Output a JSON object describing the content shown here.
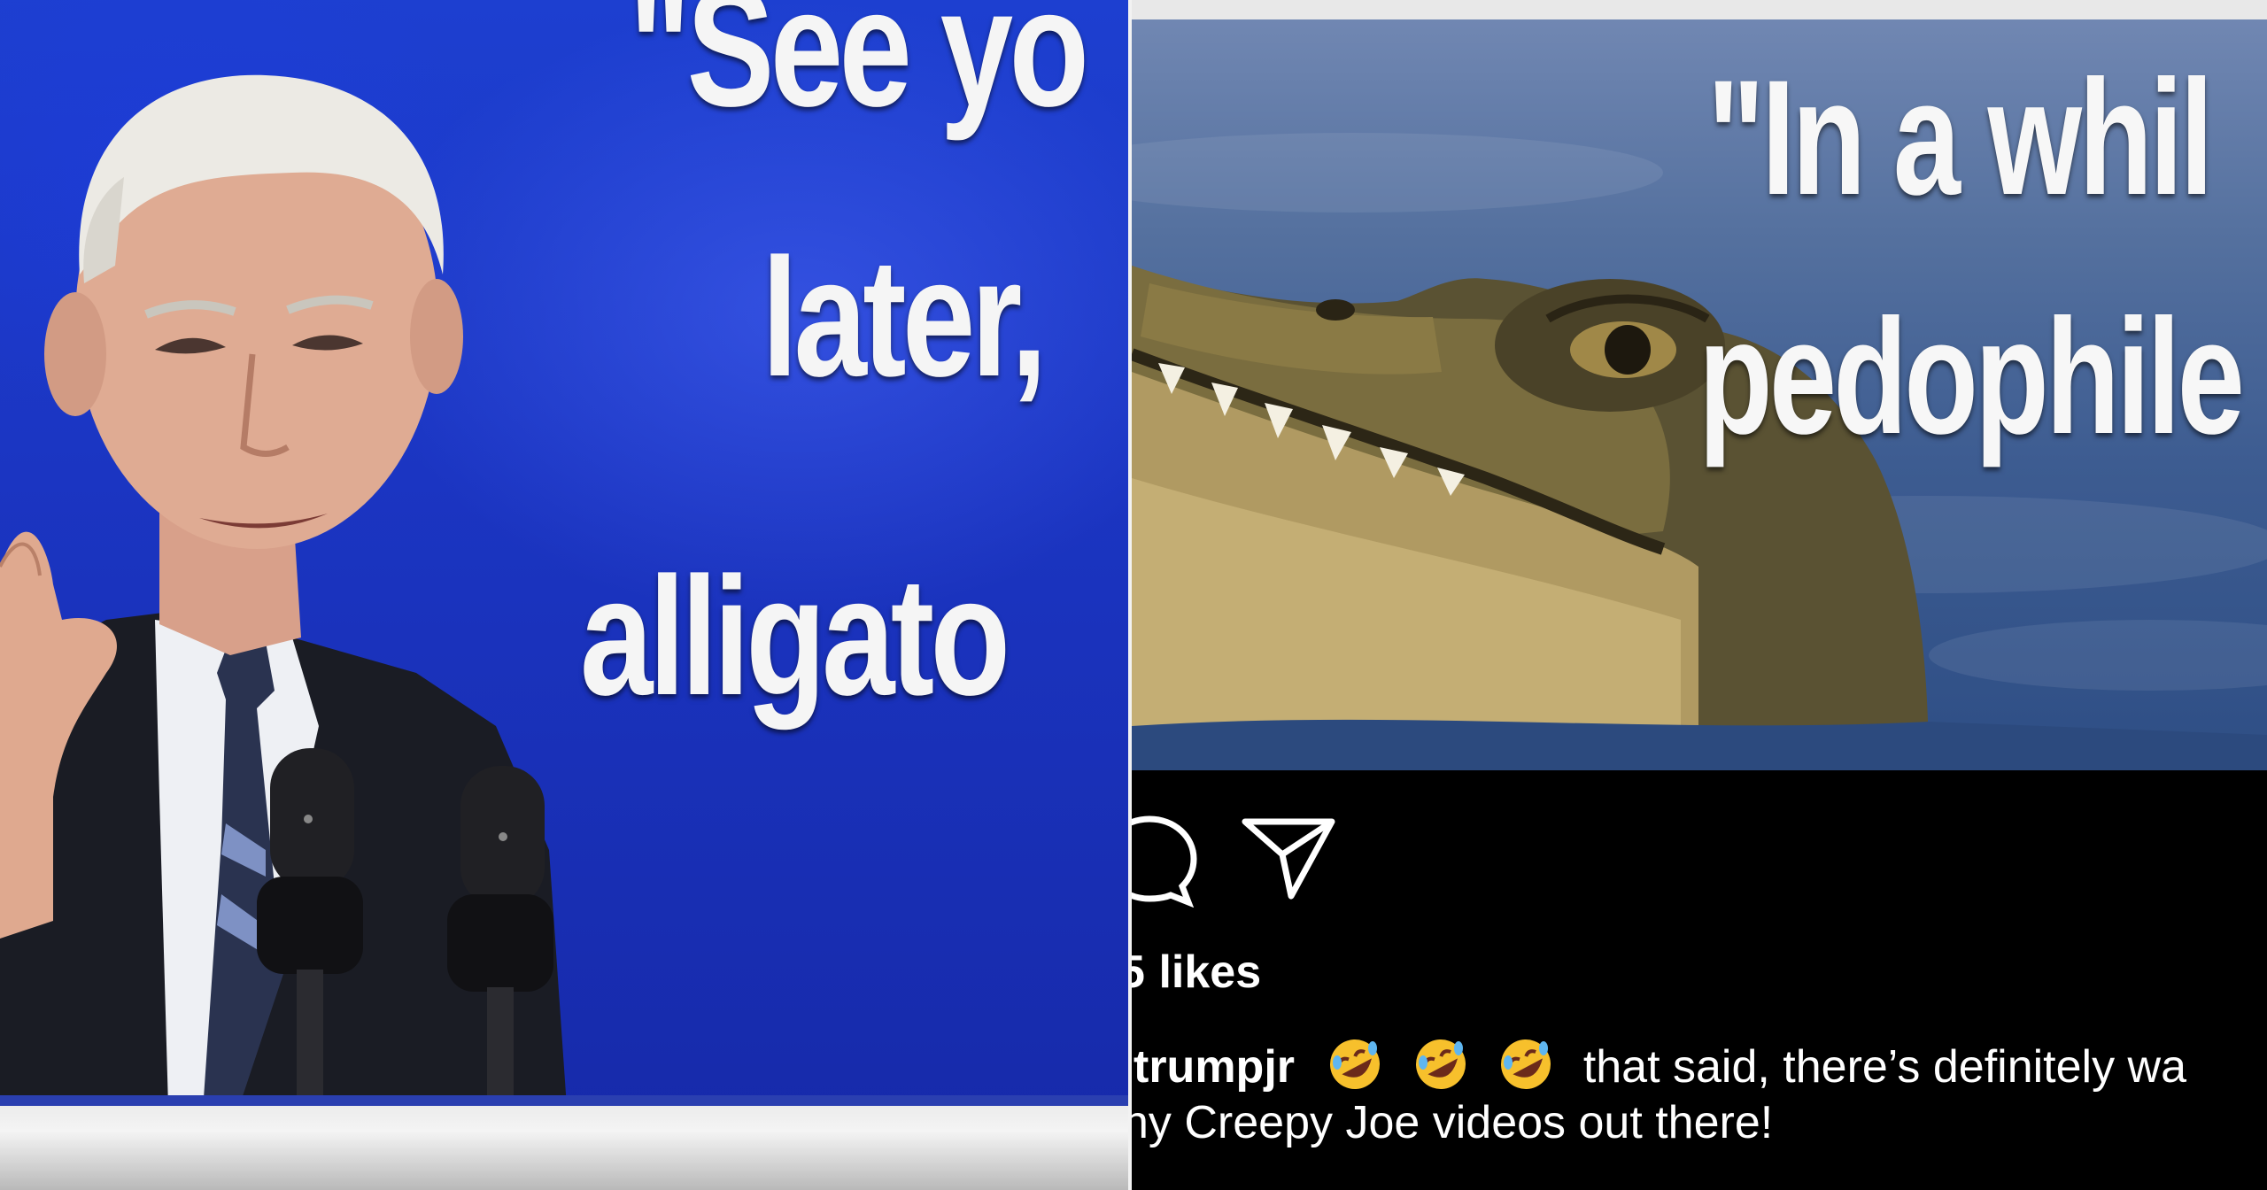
{
  "left_meme": {
    "line1": "\"See yo",
    "line2": "later,",
    "line3": "alligato"
  },
  "right_meme": {
    "line1": "\"In a whil",
    "line2": "pedophile"
  },
  "post": {
    "likes_label": "likes",
    "likes_partial_digit": "5",
    "caption": {
      "username": "trumpjr",
      "emojis": [
        "rolling-on-floor-laughing",
        "rolling-on-floor-laughing",
        "rolling-on-floor-laughing"
      ],
      "text_line1": "that said, there’s definitely wa",
      "text_line2": "ny Creepy Joe videos out there!"
    }
  },
  "colors": {
    "left_background": "#1d3fd0",
    "text_white": "#ffffff",
    "post_background": "#000000"
  },
  "icons": [
    "comment-icon",
    "share-icon",
    "emoji-laughing-icon"
  ]
}
